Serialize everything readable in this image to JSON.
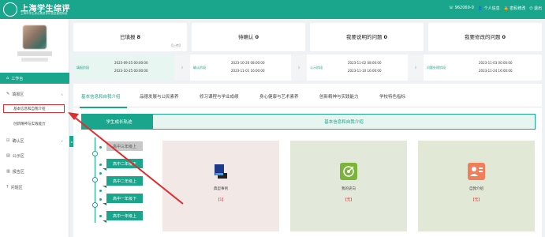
{
  "header": {
    "title": "上海学生综评",
    "subtitle": "上海市学生综合素质评价信息管理系统",
    "phone": "962069-0",
    "personal_info": "个人信息",
    "change_password": "密码修改",
    "logout": "退出"
  },
  "sidebar": {
    "items": [
      {
        "label": "工作台",
        "icon": "home-icon"
      },
      {
        "label": "填报区",
        "icon": "edit-icon",
        "caret": "∧"
      },
      {
        "label": "基本信息和自我介绍"
      },
      {
        "label": "创新精神与实践能力"
      },
      {
        "label": "确认区",
        "icon": "check-icon",
        "caret": "∨"
      },
      {
        "label": "公示区",
        "icon": "doc-icon"
      },
      {
        "label": "报告区",
        "icon": "report-icon"
      },
      {
        "label": "问题区",
        "icon": "question-icon"
      }
    ]
  },
  "stats": [
    {
      "label": "已填报",
      "count": "8",
      "link": "【上传】"
    },
    {
      "label": "待确认",
      "count": "0"
    },
    {
      "label": "我要说明的问题",
      "count": "0"
    },
    {
      "label": "我要修改的问题",
      "count": "0"
    }
  ],
  "process": [
    {
      "label": "填报阶段",
      "start": "2023-09-25 00:00:00",
      "end": "2023-10-25 00:00:00"
    },
    {
      "label": "确认阶段",
      "start": "2023-10-26 08:00:00",
      "end": "2023-11-01 16:00:00"
    },
    {
      "label": "公示阶段",
      "start": "2023-11-02 08:00:00",
      "end": "2023-11-10 16:00:00"
    },
    {
      "label": "问题处理阶段",
      "start": "2023-11-03 00:00:00",
      "end": "2023-11-24 16:00:00"
    }
  ],
  "tabs": [
    "基本信息和自我介绍",
    "品德发展与公民素养",
    "修习课程与学业成绩",
    "身心健康与艺术素养",
    "创新精神与实践能力",
    "学校特色指标"
  ],
  "section": {
    "growth_title": "学生成长轨迹",
    "intro_title": "基本信息和自我介绍"
  },
  "grades": [
    "高中三年级上",
    "高中二年级下",
    "高中二年级上",
    "高中一年级下",
    "高中一年级上"
  ],
  "cards": [
    {
      "title": "典型事例",
      "badge": "【1】",
      "icon": "profile-icon"
    },
    {
      "title": "我的史向",
      "badge": "【无】",
      "icon": "target-icon"
    },
    {
      "title": "自我介绍",
      "badge": "【无】",
      "icon": "person-icon"
    }
  ],
  "colors": {
    "accent": "#1aa68c",
    "highlight": "#e02d2d"
  }
}
